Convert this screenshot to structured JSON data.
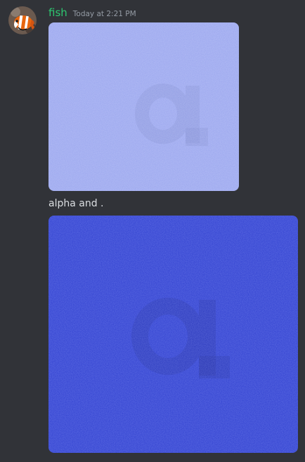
{
  "message": {
    "author": "fish",
    "author_color": "#2dc770",
    "timestamp": "Today at 2:21 PM",
    "text": "alpha and .",
    "avatar_icon": "clownfish-avatar-icon",
    "attachments": [
      {
        "type": "image",
        "dominant_color": "#9aa6ee"
      },
      {
        "type": "image",
        "dominant_color": "#2f3fcf"
      }
    ]
  }
}
